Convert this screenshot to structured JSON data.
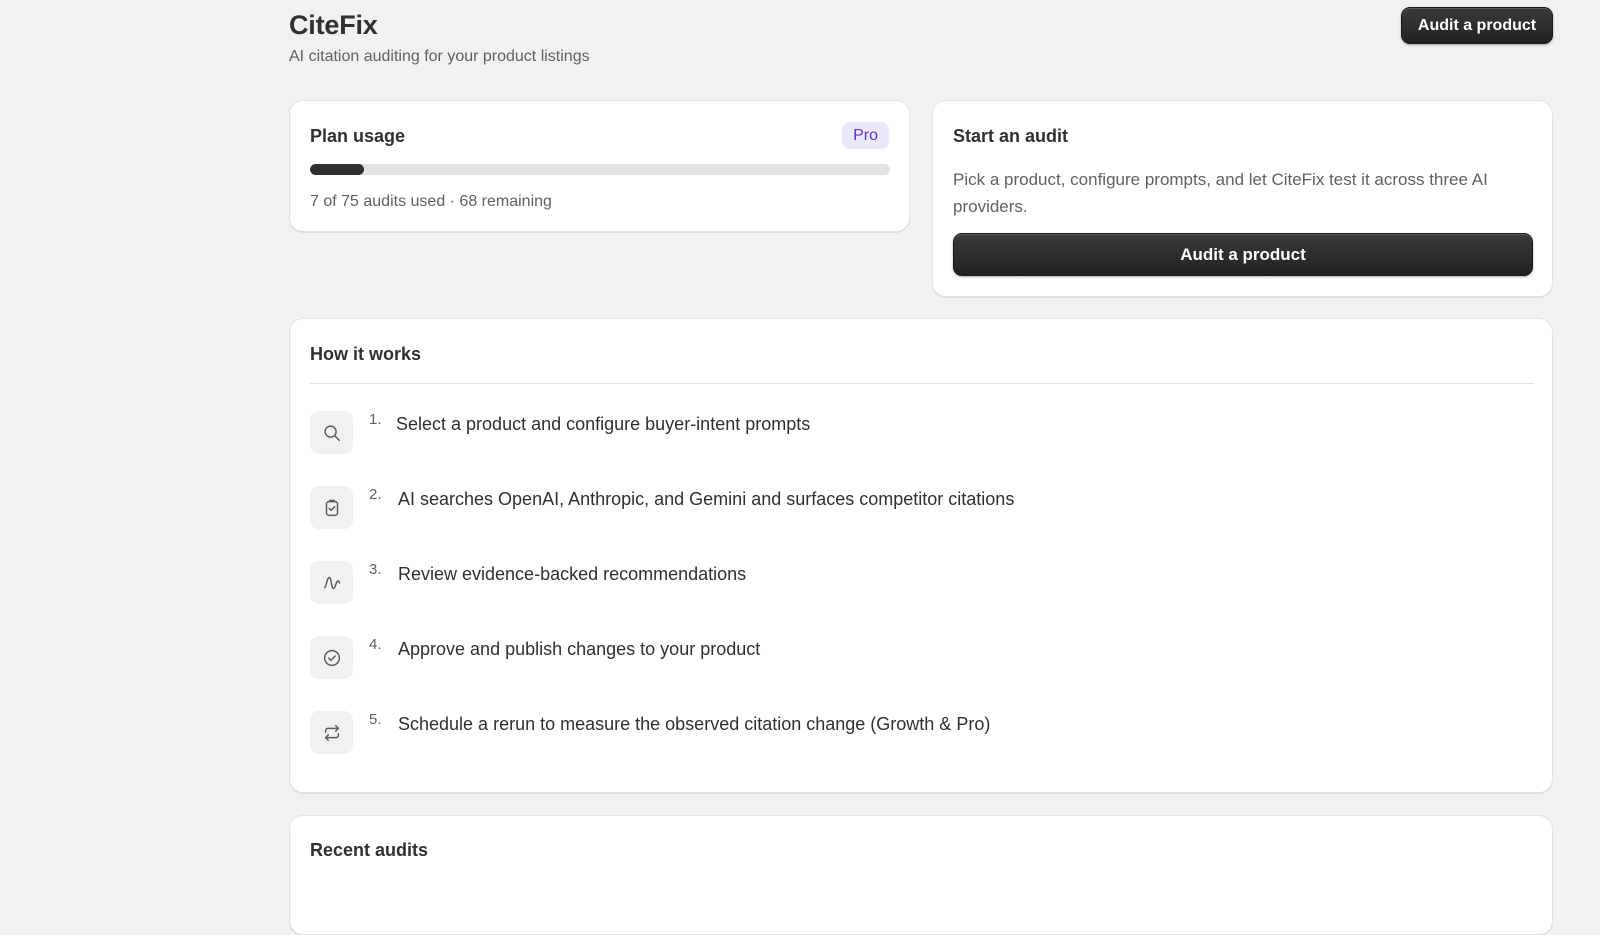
{
  "app": {
    "title": "CiteFix",
    "subtitle": "AI citation auditing for your product listings",
    "header_button": "Audit a product"
  },
  "plan_usage": {
    "title": "Plan usage",
    "badge": "Pro",
    "used": 7,
    "total": 75,
    "progress_fraction": 0.093,
    "summary": "7 of 75 audits used · 68 remaining"
  },
  "start_audit": {
    "title": "Start an audit",
    "description": "Pick a product, configure prompts, and let CiteFix test it across three AI providers.",
    "button": "Audit a product"
  },
  "how_it_works": {
    "title": "How it works",
    "steps": [
      {
        "number": "1.",
        "text": "Select a product and configure buyer-intent prompts",
        "icon": "search-icon"
      },
      {
        "number": "2.",
        "text": "AI searches OpenAI, Anthropic, and Gemini and surfaces competitor citations",
        "icon": "clipboard-check-icon"
      },
      {
        "number": "3.",
        "text": "Review evidence-backed recommendations",
        "icon": "pulse-icon"
      },
      {
        "number": "4.",
        "text": "Approve and publish changes to your product",
        "icon": "check-circle-icon"
      },
      {
        "number": "5.",
        "text": "Schedule a rerun to measure the observed citation change (Growth & Pro)",
        "icon": "repeat-icon"
      }
    ]
  },
  "recent_audits": {
    "title": "Recent audits"
  },
  "colors": {
    "background": "#f1f1f1",
    "primary_button": "#303030",
    "badge_bg": "#ece8fb",
    "badge_text": "#5b35c9"
  }
}
